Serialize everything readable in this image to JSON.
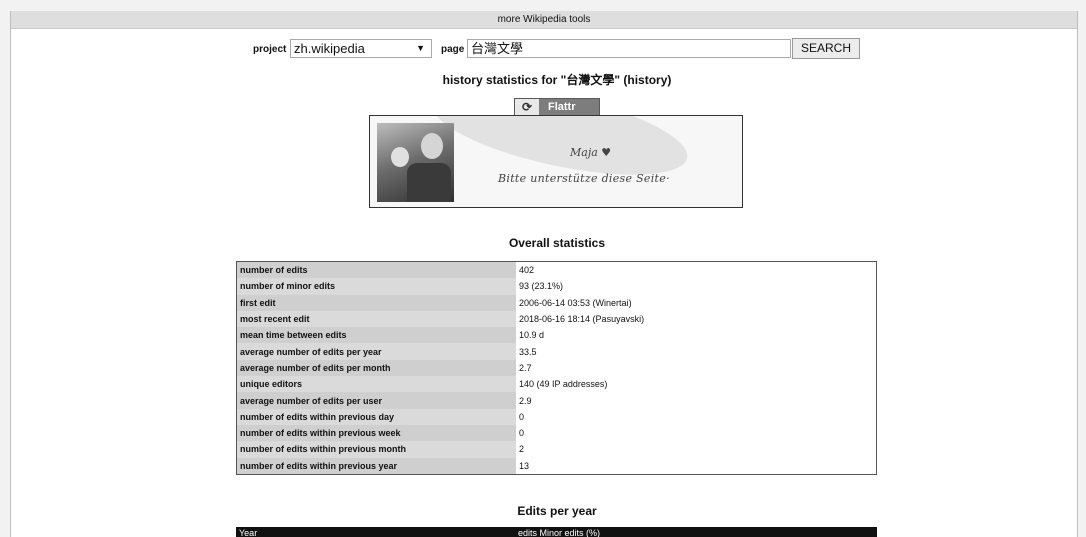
{
  "topbar": {
    "link": "more Wikipedia tools"
  },
  "search": {
    "project_label": "project",
    "project_value": "zh.wikipedia",
    "page_label": "page",
    "page_value": "台灣文學",
    "button": "SEARCH"
  },
  "history_title": "history statistics for \"台灣文學\" (history)",
  "flattr": {
    "label": "Flattr",
    "icon": "refresh-icon"
  },
  "banner": {
    "line1": "Maja ♥",
    "line2": "Bitte unterstütze diese Seite·"
  },
  "overall": {
    "title": "Overall statistics",
    "rows": [
      {
        "k": "number of edits",
        "v": "402"
      },
      {
        "k": "number of minor edits",
        "v": "93 (23.1%)"
      },
      {
        "k": "first edit",
        "v": "2006-06-14 03:53 (Winertai)"
      },
      {
        "k": "most recent edit",
        "v": "2018-06-16 18:14 (Pasuyavski)"
      },
      {
        "k": "mean time between edits",
        "v": "10.9 d"
      },
      {
        "k": "average number of edits per year",
        "v": "33.5"
      },
      {
        "k": "average number of edits per month",
        "v": "2.7"
      },
      {
        "k": "unique editors",
        "v": "140 (49 IP addresses)"
      },
      {
        "k": "average number of edits per user",
        "v": "2.9"
      },
      {
        "k": "number of edits within previous day",
        "v": "0"
      },
      {
        "k": "number of edits within previous week",
        "v": "0"
      },
      {
        "k": "number of edits within previous month",
        "v": "2"
      },
      {
        "k": "number of edits within previous year",
        "v": "13"
      }
    ]
  },
  "per_year": {
    "title": "Edits per year",
    "col_year": "Year",
    "col_rest": "edits Minor edits    (%)"
  }
}
